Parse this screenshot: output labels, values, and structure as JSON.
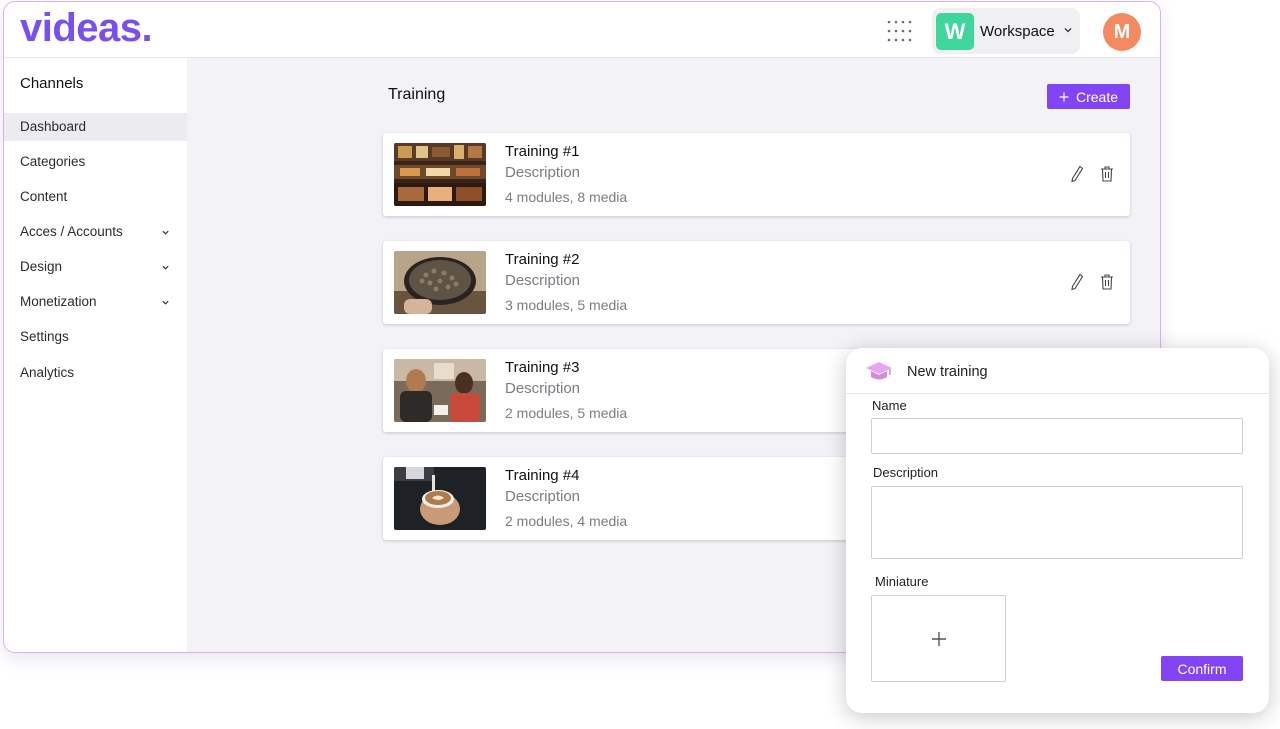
{
  "app": {
    "logo": "videas."
  },
  "topbar": {
    "workspace_initial": "W",
    "workspace_label": "Workspace",
    "avatar_initial": "M",
    "icons": {
      "apps": "grid-dots-icon",
      "workspace_toggle": "chevron-down-icon"
    }
  },
  "sidebar": {
    "heading": "Channels",
    "items": [
      {
        "label": "Dashboard",
        "active": true,
        "expandable": false
      },
      {
        "label": "Categories",
        "active": false,
        "expandable": false
      },
      {
        "label": "Content",
        "active": false,
        "expandable": false
      },
      {
        "label": "Acces / Accounts",
        "active": false,
        "expandable": true
      },
      {
        "label": "Design",
        "active": false,
        "expandable": true
      },
      {
        "label": "Monetization",
        "active": false,
        "expandable": true
      },
      {
        "label": "Settings",
        "active": false,
        "expandable": false
      },
      {
        "label": "Analytics",
        "active": false,
        "expandable": false
      }
    ]
  },
  "main": {
    "title": "Training",
    "create_label": "Create",
    "trainings": [
      {
        "title": "Training #1",
        "description": "Description",
        "meta": "4 modules, 8 media",
        "thumbnail": "coffee-shop-counter"
      },
      {
        "title": "Training #2",
        "description": "Description",
        "meta": "3 modules, 5 media",
        "thumbnail": "coffee-beans-bowl"
      },
      {
        "title": "Training #3",
        "description": "Description",
        "meta": "2 modules, 5 media",
        "thumbnail": "cafe-conversation"
      },
      {
        "title": "Training #4",
        "description": "Description",
        "meta": "2 modules, 4 media",
        "thumbnail": "latte-art-pour"
      }
    ]
  },
  "modal": {
    "title": "New training",
    "icon": "graduation-cap-icon",
    "name_label": "Name",
    "name_value": "",
    "description_label": "Description",
    "description_value": "",
    "miniature_label": "Miniature",
    "confirm_label": "Confirm"
  },
  "colors": {
    "brand": "#7a4ff0",
    "button": "#8344f5",
    "workspace_badge": "#3ed69d",
    "avatar": "#f48a62",
    "window_border": "#d6b4f0",
    "canvas": "#f2f2f7"
  }
}
